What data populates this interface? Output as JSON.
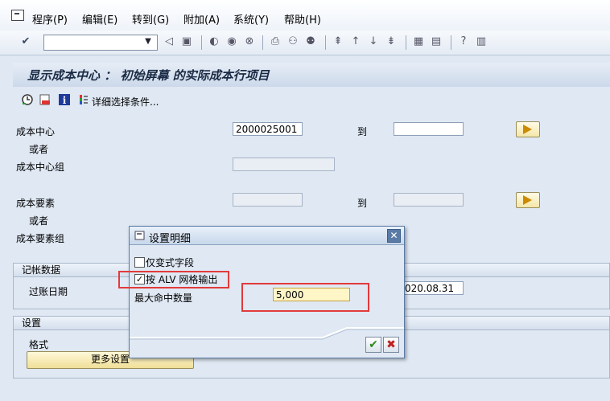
{
  "menu": {
    "items": [
      {
        "label": "程序(P)"
      },
      {
        "label": "编辑(E)"
      },
      {
        "label": "转到(G)"
      },
      {
        "label": "附加(A)"
      },
      {
        "label": "系统(Y)"
      },
      {
        "label": "帮助(H)"
      }
    ]
  },
  "toolbar": {
    "command_value": "",
    "icons": [
      "check-icon",
      "back-icon",
      "save-icon",
      "back-nav-icon",
      "exit-icon",
      "cancel-icon",
      "print-icon",
      "find-icon",
      "find-next-icon",
      "first-page-icon",
      "prev-page-icon",
      "next-page-icon",
      "last-page-icon",
      "new-session-icon",
      "shortcut-icon",
      "help-icon",
      "layout-icon"
    ]
  },
  "page": {
    "title": "显示成本中心 ： 初始屏幕 的实际成本行项目"
  },
  "app_toolbar": {
    "detail_label": "详细选择条件..."
  },
  "selection": {
    "cost_center_label": "成本中心",
    "cost_center_value": "2000025001",
    "to_label_1": "到",
    "or_label_1": "或者",
    "cost_center_group_label": "成本中心组",
    "cost_element_label": "成本要素",
    "to_label_2": "到",
    "or_label_2": "或者",
    "cost_element_group_label": "成本要素组"
  },
  "posting": {
    "header": "记帐数据",
    "posting_date_label": "过账日期",
    "posting_date_to_partial": "020.08.31"
  },
  "settings": {
    "header": "设置",
    "layout_label": "格式",
    "more_button": "更多设置"
  },
  "dialog": {
    "title": "设置明细",
    "only_changeable_label": "仅变式字段",
    "only_changeable_checked": false,
    "alv_label": "按 ALV 网格输出",
    "alv_checked": true,
    "max_hits_label": "最大命中数量",
    "max_hits_value": "5,000"
  },
  "colors": {
    "highlight_red": "#e23b3b",
    "sap_bg": "#dfe8f3",
    "dialog_border": "#5a7ba6"
  }
}
